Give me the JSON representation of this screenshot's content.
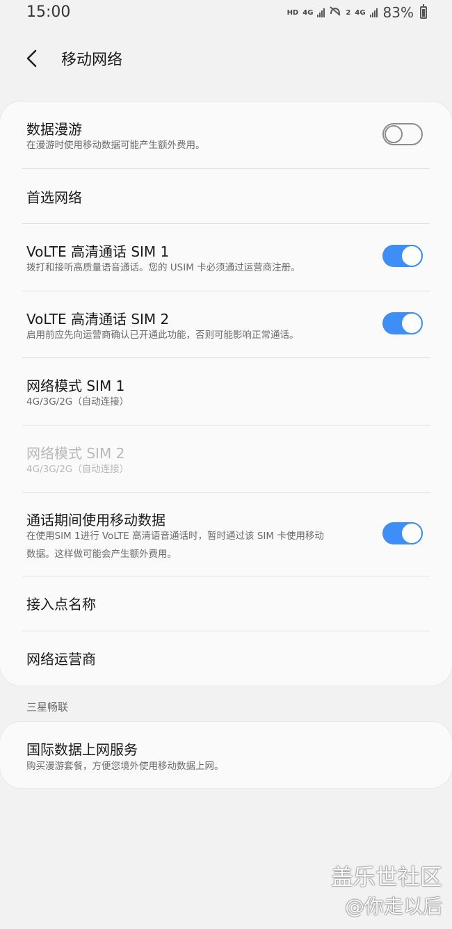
{
  "status_bar": {
    "time": "15:00",
    "hd": "HD",
    "net1": "4G",
    "net2": "4G",
    "sim2_mark": "2",
    "battery": "83%"
  },
  "header": {
    "title": "移动网络"
  },
  "settings": {
    "data_roaming": {
      "title": "数据漫游",
      "subtitle": "在漫游时使用移动数据可能产生额外费用。",
      "enabled": false
    },
    "preferred_network": {
      "title": "首选网络"
    },
    "volte_sim1": {
      "title": "VoLTE 高清通话 SIM 1",
      "subtitle": "拨打和接听高质量语音通话。您的 USIM 卡必须通过运营商注册。",
      "enabled": true
    },
    "volte_sim2": {
      "title": "VoLTE 高清通话 SIM 2",
      "subtitle": "启用前应先向运营商确认已开通此功能，否则可能影响正常通话。",
      "enabled": true
    },
    "network_mode_sim1": {
      "title": "网络模式 SIM 1",
      "subtitle": "4G/3G/2G（自动连接）"
    },
    "network_mode_sim2": {
      "title": "网络模式 SIM 2",
      "subtitle": "4G/3G/2G（自动连接）",
      "disabled": true
    },
    "data_during_calls": {
      "title": "通话期间使用移动数据",
      "subtitle_line1": "在使用SIM 1进行 VoLTE 高清语音通话时，暂时通过该 SIM 卡使用移动",
      "subtitle_line2": "数据。这样做可能会产生额外费用。",
      "enabled": true
    },
    "apn": {
      "title": "接入点名称"
    },
    "network_operators": {
      "title": "网络运营商"
    }
  },
  "samsung_section": {
    "label": "三星畅联",
    "intl_data": {
      "title": "国际数据上网服务",
      "subtitle": "购买漫游套餐，方便您境外使用移动数据上网。"
    }
  },
  "watermark": {
    "line1": "盖乐世社区",
    "line2": "@你走以后"
  },
  "colors": {
    "accent": "#3e8ef7",
    "background": "#f2f2f2",
    "card": "#fafafa"
  }
}
